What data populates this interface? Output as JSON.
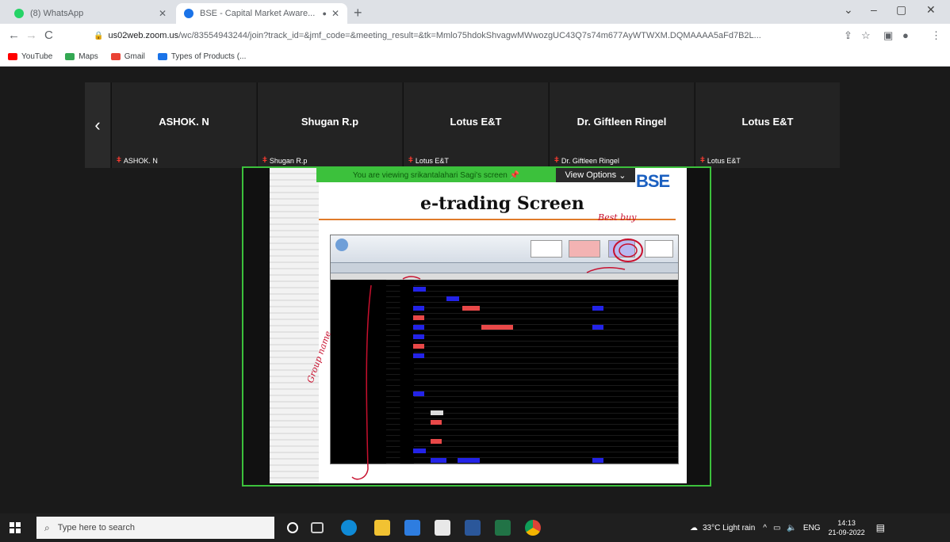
{
  "browser": {
    "tabs": [
      {
        "title": "(8) WhatsApp",
        "favicon_color": "#25d366"
      },
      {
        "title": "BSE - Capital Market Aware...",
        "favicon_color": "#1a73e8"
      }
    ],
    "url_host": "us02web.zoom.us",
    "url_rest": "/wc/83554943244/join?track_id=&jmf_code=&meeting_result=&tk=Mmlo75hdokShvagwMWwozgUC43Q7s74m677AyWTWXM.DQMAAAA5aFd7B2L...",
    "bookmarks": [
      {
        "label": "YouTube",
        "color": "#ff0000"
      },
      {
        "label": "Maps",
        "color": "#34a853"
      },
      {
        "label": "Gmail",
        "color": "#ea4335"
      },
      {
        "label": "Types of Products (...",
        "color": "#1a73e8"
      }
    ]
  },
  "meeting": {
    "participants": [
      {
        "name": "ASHOK. N",
        "label": "ASHOK. N"
      },
      {
        "name": "Shugan R.p",
        "label": "Shugan R.p"
      },
      {
        "name": "Lotus E&T",
        "label": "Lotus E&T"
      },
      {
        "name": "Dr. Giftleen Ringel",
        "label": "Dr. Giftleen Ringel"
      },
      {
        "name": "Lotus E&T",
        "label": "Lotus E&T"
      }
    ],
    "share_banner": "You are viewing srikantalahari Sagi's screen",
    "view_options": "View Options",
    "slide": {
      "logo": "BSE",
      "title": "e-trading Screen",
      "annotations": [
        "Best buy",
        "Group name"
      ]
    }
  },
  "taskbar": {
    "search_placeholder": "Type here to search",
    "weather": "33°C  Light rain",
    "lang": "ENG",
    "time": "14:13",
    "date": "21-09-2022"
  }
}
